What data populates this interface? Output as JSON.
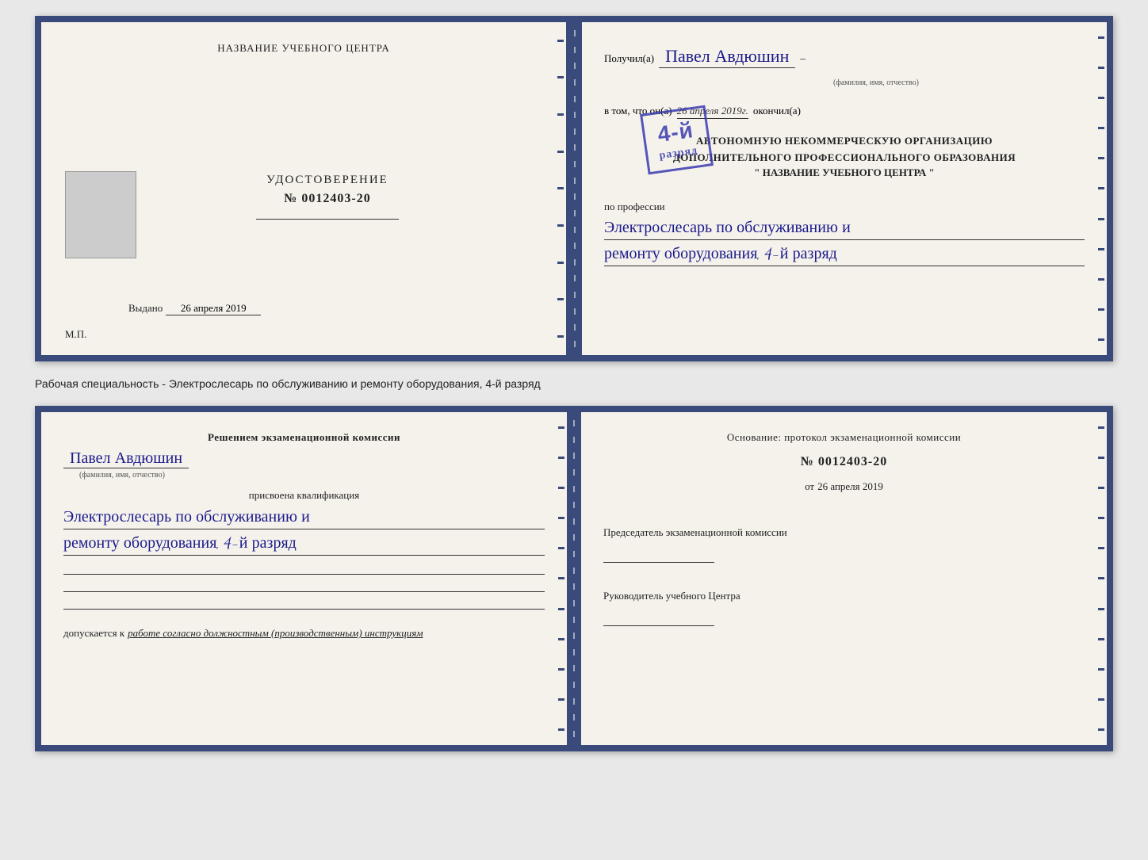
{
  "doc1": {
    "left": {
      "center_title": "НАЗВАНИЕ УЧЕБНОГО ЦЕНТРА",
      "photo_placeholder": "",
      "cert_label": "УДОСТОВЕРЕНИЕ",
      "cert_number": "№ 0012403-20",
      "issued_label": "Выдано",
      "issued_date": "26 апреля 2019",
      "mp_label": "М.П."
    },
    "right": {
      "received_prefix": "Получил(а)",
      "recipient_name": "Павел Авдюшин",
      "fio_label": "(фамилия, имя, отчество)",
      "in_that": "в том, что он(а)",
      "date_italic": "26 апреля 2019г.",
      "finished": "окончил(а)",
      "org_line1": "АВТОНОМНУЮ НЕКОММЕРЧЕСКУЮ ОРГАНИЗАЦИЮ",
      "org_line2": "ДОПОЛНИТЕЛЬНОГО ПРОФЕССИОНАЛЬНОГО ОБРАЗОВАНИЯ",
      "org_name": "\" НАЗВАНИЕ УЧЕБНОГО ЦЕНТРА \"",
      "stamp_lines": [
        "4-й",
        "разряд"
      ],
      "profession_label": "по профессии",
      "profession_handwritten1": "Электрослесарь по обслуживанию и",
      "profession_handwritten2": "ремонту оборудования, 4-й разряд"
    }
  },
  "caption": "Рабочая специальность - Электрослесарь по обслуживанию и ремонту оборудования, 4-й разряд",
  "doc2": {
    "left": {
      "commission_heading": "Решением экзаменационной комиссии",
      "name_handwritten": "Павел Авдюшин",
      "fio_label": "(фамилия, имя, отчество)",
      "qualification_label": "присвоена квалификация",
      "qual_handwritten1": "Электрослесарь по обслуживанию и",
      "qual_handwritten2": "ремонту оборудования, 4-й разряд",
      "allowed_label": "допускается к",
      "allowed_text": "работе согласно должностным (производственным) инструкциям"
    },
    "right": {
      "basis_label": "Основание: протокол экзаменационной комиссии",
      "protocol_number": "№ 0012403-20",
      "date_prefix": "от",
      "date_value": "26 апреля 2019",
      "chairman_label": "Председатель экзаменационной комиссии",
      "director_label": "Руководитель учебного Центра"
    }
  }
}
